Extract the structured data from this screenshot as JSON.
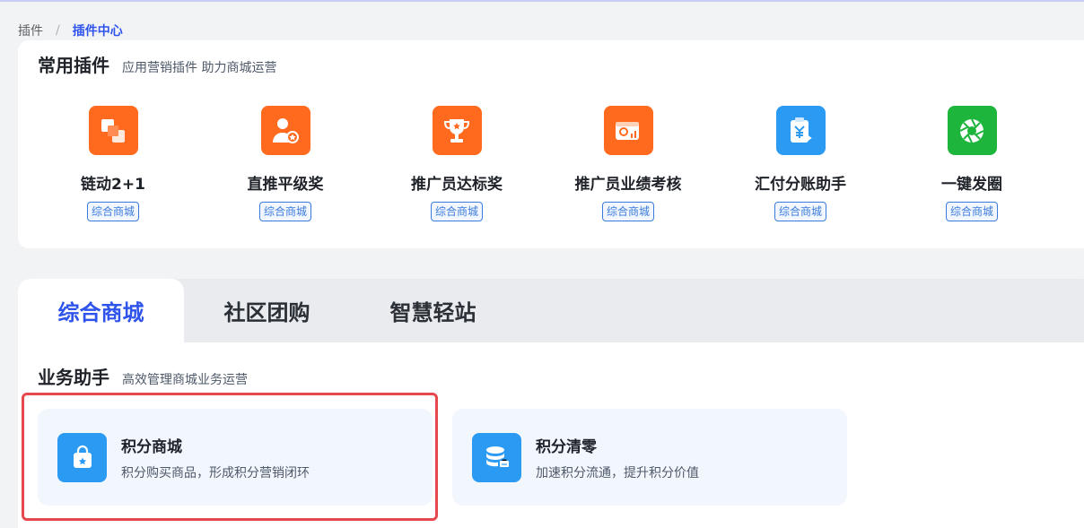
{
  "breadcrumb": {
    "root": "插件",
    "separator": "/",
    "current": "插件中心"
  },
  "common_plugins": {
    "title": "常用插件",
    "subtitle": "应用营销插件 助力商城运营",
    "items": [
      {
        "name": "链动2+1",
        "tag": "综合商城",
        "icon": "layers-icon",
        "color": "#ff6a1e"
      },
      {
        "name": "直推平级奖",
        "tag": "综合商城",
        "icon": "user-medal-icon",
        "color": "#ff6a1e"
      },
      {
        "name": "推广员达标奖",
        "tag": "综合商城",
        "icon": "trophy-icon",
        "color": "#ff6a1e"
      },
      {
        "name": "推广员业绩考核",
        "tag": "综合商城",
        "icon": "wallet-chart-icon",
        "color": "#ff6a1e"
      },
      {
        "name": "汇付分账助手",
        "tag": "综合商城",
        "icon": "yuan-clipboard-icon",
        "color": "#2b9af3"
      },
      {
        "name": "一键发圈",
        "tag": "综合商城",
        "icon": "aperture-icon",
        "color": "#1db53c"
      }
    ]
  },
  "tabs": [
    {
      "label": "综合商城",
      "active": true
    },
    {
      "label": "社区团购",
      "active": false
    },
    {
      "label": "智慧轻站",
      "active": false
    }
  ],
  "business": {
    "title": "业务助手",
    "subtitle": "高效管理商城业务运营",
    "items": [
      {
        "name": "积分商城",
        "desc": "积分购买商品，形成积分营销闭环",
        "icon": "shopping-bag-icon"
      },
      {
        "name": "积分清零",
        "desc": "加速积分流通，提升积分价值",
        "icon": "database-clear-icon"
      }
    ]
  },
  "colors": {
    "accent": "#2f54eb",
    "orange": "#ff6a1e",
    "blue": "#2b9af3",
    "green": "#1db53c",
    "highlight": "#e5484d"
  }
}
